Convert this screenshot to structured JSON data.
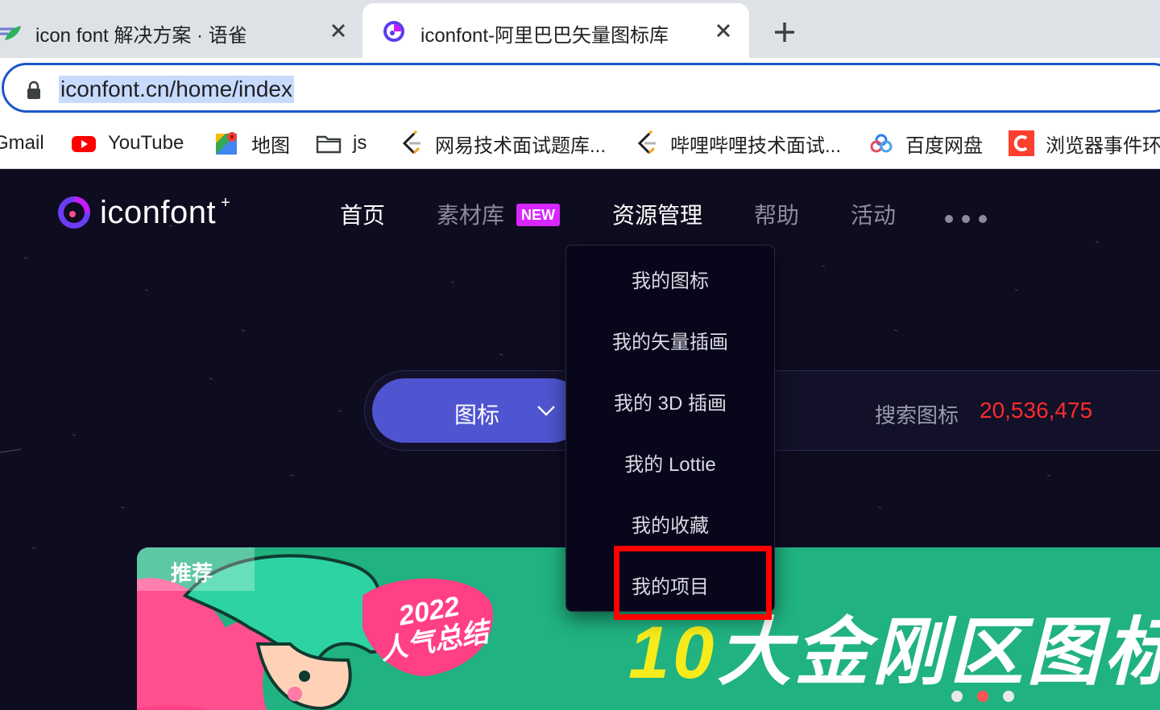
{
  "browser": {
    "tabs": [
      {
        "title": "icon font 解决方案 · 语雀",
        "active": false
      },
      {
        "title": "iconfont-阿里巴巴矢量图标库",
        "active": true
      }
    ],
    "url": "iconfont.cn/home/index",
    "bookmarks": [
      {
        "label": "Gmail",
        "icon": "gmail-icon"
      },
      {
        "label": "YouTube",
        "icon": "youtube-icon"
      },
      {
        "label": "地图",
        "icon": "maps-icon"
      },
      {
        "label": "js",
        "icon": "folder-icon"
      },
      {
        "label": "网易技术面试题库...",
        "icon": "leetcode-icon"
      },
      {
        "label": "哔哩哔哩技术面试...",
        "icon": "leetcode-icon"
      },
      {
        "label": "百度网盘",
        "icon": "baidu-pan-icon"
      },
      {
        "label": "浏览器事件环",
        "icon": "csdn-icon"
      }
    ]
  },
  "site": {
    "logo_text": "iconfont",
    "logo_plus": "+",
    "nav": [
      {
        "label": "首页",
        "state": "active"
      },
      {
        "label": "素材库",
        "badge": "NEW"
      },
      {
        "label": "资源管理",
        "state": "open"
      },
      {
        "label": "帮助"
      },
      {
        "label": "活动"
      }
    ],
    "search": {
      "type_label": "图标",
      "placeholder": "搜索图标",
      "count": "20,536,475"
    },
    "resource_menu": [
      "我的图标",
      "我的矢量插画",
      "我的 3D 插画",
      "我的 Lottie",
      "我的收藏",
      "我的项目"
    ],
    "highlighted_menu_item": "我的项目",
    "banner": {
      "tag": "推荐",
      "year": "2022",
      "subtitle": "人气总结",
      "heading_num": "10",
      "heading_text": "大金刚区图标设",
      "carousel_active_index": 1,
      "carousel_count": 3
    }
  },
  "colors": {
    "accent": "#4f54d0",
    "count_red": "#ff2b2b",
    "new_badge": "#d726ff",
    "highlight": "#ff0000",
    "banner_green": "#20b280"
  }
}
